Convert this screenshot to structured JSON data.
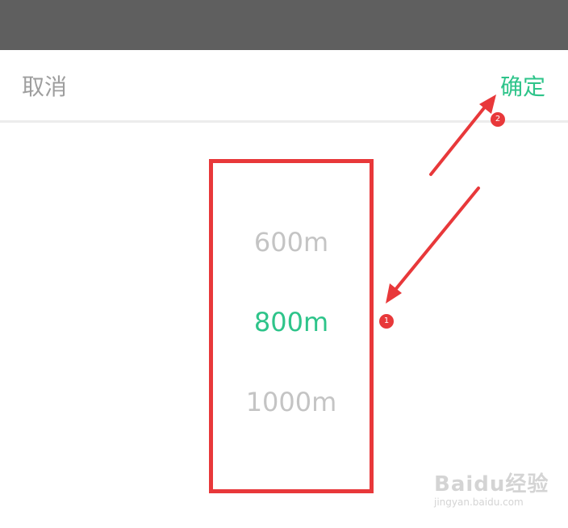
{
  "header": {
    "cancel_label": "取消",
    "confirm_label": "确定"
  },
  "picker": {
    "options": [
      "600m",
      "800m",
      "1000m"
    ],
    "selected_index": 1
  },
  "annotations": {
    "badge_1": "1",
    "badge_2": "2"
  },
  "watermark": {
    "brand": "Baidu经验",
    "url": "jingyan.baidu.com"
  },
  "colors": {
    "accent": "#2ec48a",
    "annotation": "#e8383a",
    "status_bar": "#5f5f5f",
    "muted_text": "#9e9e9e"
  }
}
